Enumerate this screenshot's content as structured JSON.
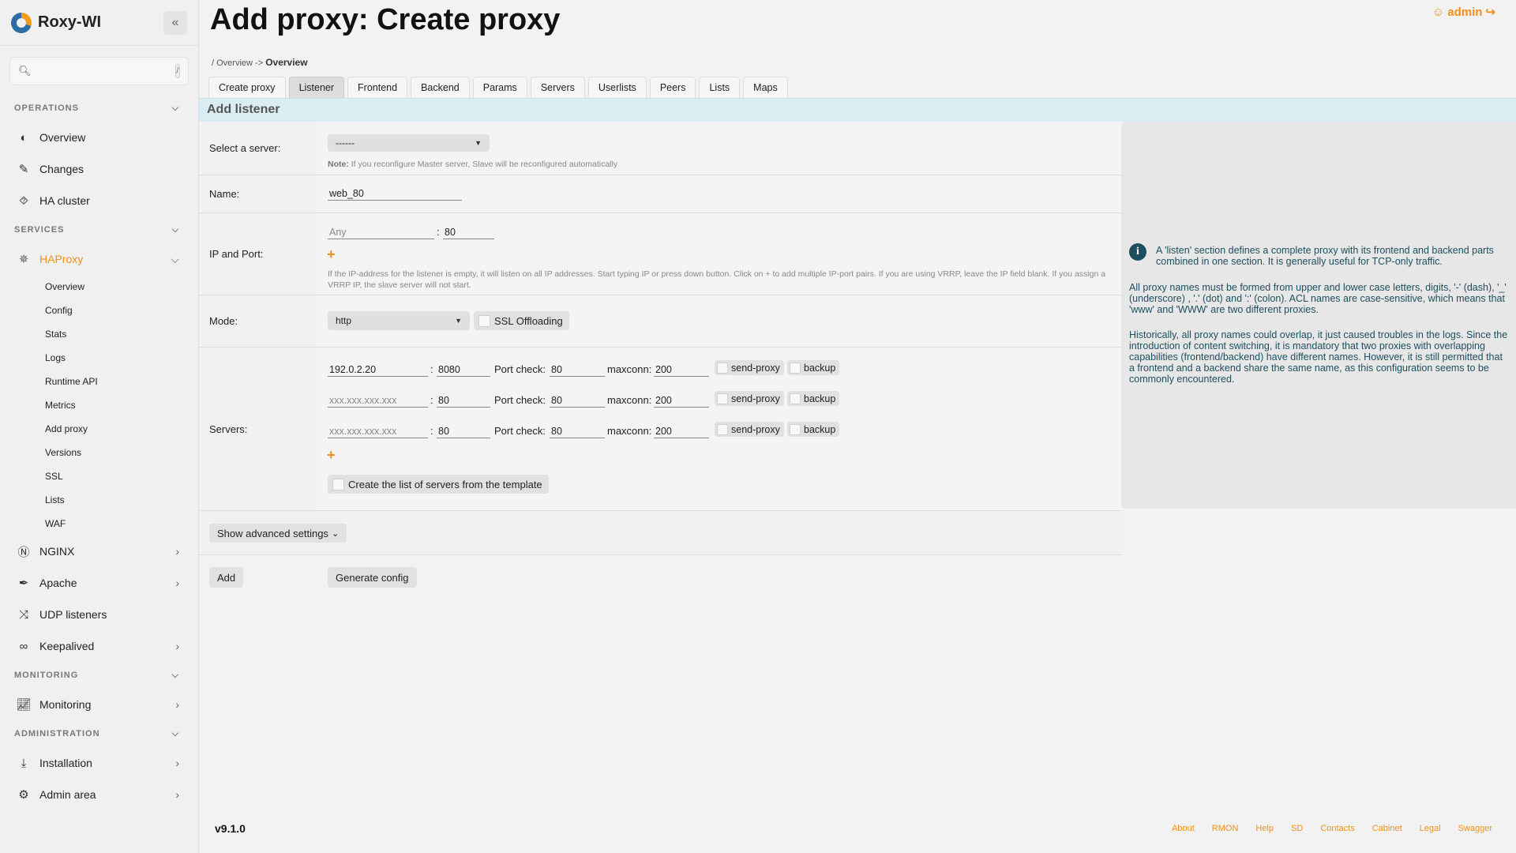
{
  "app": {
    "name": "Roxy-WI"
  },
  "search": {
    "placeholder": "",
    "shortcut": "/"
  },
  "sidebar": {
    "sections": {
      "operations": "OPERATIONS",
      "services": "SERVICES",
      "monitoring": "MONITORING",
      "administration": "ADMINISTRATION"
    },
    "items": {
      "overview": "Overview",
      "changes": "Changes",
      "ha_cluster": "HA cluster",
      "haproxy": "HAProxy",
      "nginx": "NGINX",
      "apache": "Apache",
      "udp": "UDP listeners",
      "keepalived": "Keepalived",
      "monitoring": "Monitoring",
      "installation": "Installation",
      "admin_area": "Admin area"
    },
    "haproxy_sub": [
      "Overview",
      "Config",
      "Stats",
      "Logs",
      "Runtime API",
      "Metrics",
      "Add proxy",
      "Versions",
      "SSL",
      "Lists",
      "WAF"
    ]
  },
  "header": {
    "title": "Add proxy: Create proxy",
    "user": "admin"
  },
  "breadcrumb": {
    "root": "/",
    "item1": "Overview",
    "sep": "->",
    "item2": "Overview"
  },
  "tabs": [
    "Create proxy",
    "Listener",
    "Frontend",
    "Backend",
    "Params",
    "Servers",
    "Userlists",
    "Peers",
    "Lists",
    "Maps"
  ],
  "section_title": "Add listener",
  "form": {
    "server_label": "Select a server:",
    "server_value": "------",
    "server_note_bold": "Note:",
    "server_note": " If you reconfigure Master server, Slave will be reconfigured automatically",
    "name_label": "Name:",
    "name_value": "web_80",
    "ip_label": "IP and Port:",
    "ip_placeholder": "Any",
    "port_value": "80",
    "ip_note": "If the IP-address for the listener is empty, it will listen on all IP addresses. Start typing IP or press down button. Click on + to add multiple IP-port pairs. If you are using VRRP, leave the IP field blank. If you assign a VRRP IP, the slave server will not start.",
    "mode_label": "Mode:",
    "mode_value": "http",
    "ssl_label": "SSL Offloading",
    "servers_label": "Servers:",
    "port_check_label": "Port check:",
    "maxconn_label": "maxconn:",
    "send_proxy_label": "send-proxy",
    "backup_label": "backup",
    "server_placeholder": "xxx.xxx.xxx.xxx",
    "servers": [
      {
        "ip": "192.0.2.20",
        "port": "8080",
        "check": "80",
        "maxconn": "200"
      },
      {
        "ip": "",
        "port": "80",
        "check": "80",
        "maxconn": "200"
      },
      {
        "ip": "",
        "port": "80",
        "check": "80",
        "maxconn": "200"
      }
    ],
    "template_label": "Create the list of servers from the template",
    "advanced_label": "Show advanced settings",
    "add_button": "Add",
    "generate_button": "Generate config"
  },
  "info": {
    "p1": "A 'listen' section defines a complete proxy with its frontend and backend parts combined in one section. It is generally useful for TCP-only traffic.",
    "p2": "All proxy names must be formed from upper and lower case letters, digits, '-' (dash), '_' (underscore) , '.' (dot) and ':' (colon). ACL names are case-sensitive, which means that 'www' and 'WWW' are two different proxies.",
    "p3": "Historically, all proxy names could overlap, it just caused troubles in the logs. Since the introduction of content switching, it is mandatory that two proxies with overlapping capabilities (frontend/backend) have different names. However, it is still permitted that a frontend and a backend share the same name, as this configuration seems to be commonly encountered."
  },
  "footer": {
    "version": "v9.1.0",
    "links": [
      "About",
      "RMON",
      "Help",
      "SD",
      "Contacts",
      "Cabinet",
      "Legal",
      "Swagger"
    ]
  },
  "colors": {
    "accent": "#f0901a",
    "info_text": "#1d4f5f",
    "section_bar": "#d9edf2"
  }
}
